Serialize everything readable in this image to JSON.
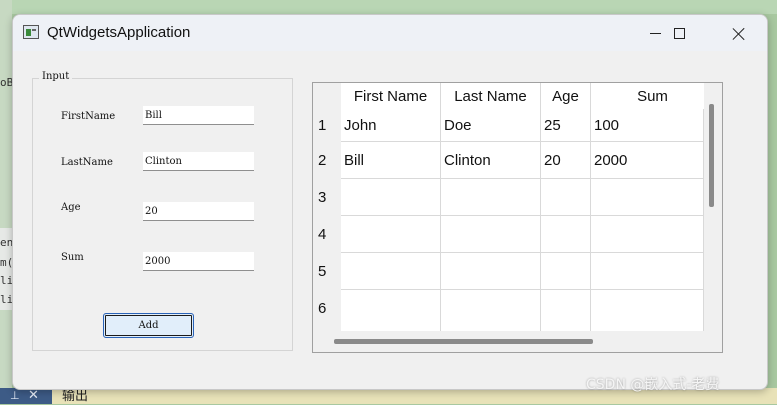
{
  "background": {
    "fragments": [
      "oB",
      "en",
      "m(",
      "li",
      "li"
    ],
    "bottom_panel_label": "输出"
  },
  "window": {
    "title": "QtWidgetsApplication",
    "controls": {
      "minimize": "minimize-icon",
      "maximize": "maximize-icon",
      "close": "close-icon"
    }
  },
  "input_group": {
    "title": "Input",
    "fields": [
      {
        "label": "FirstName",
        "value": "Bill"
      },
      {
        "label": "LastName",
        "value": "Clinton"
      },
      {
        "label": "Age",
        "value": "20"
      },
      {
        "label": "Sum",
        "value": "2000"
      }
    ],
    "add_label": "Add"
  },
  "table": {
    "headers": [
      "First Name",
      "Last Name",
      "Age",
      "Sum"
    ],
    "row_numbers": [
      "1",
      "2",
      "3",
      "4",
      "5",
      "6"
    ],
    "rows": [
      [
        "John",
        "Doe",
        "25",
        "100"
      ],
      [
        "Bill",
        "Clinton",
        "20",
        "2000"
      ],
      [
        "",
        "",
        "",
        ""
      ],
      [
        "",
        "",
        "",
        ""
      ],
      [
        "",
        "",
        "",
        ""
      ],
      [
        "",
        "",
        "",
        ""
      ]
    ]
  },
  "watermark": "CSDN @嵌入式-老费",
  "colors": {
    "accent": "#2a63b8",
    "button_bg": "#e1eefa",
    "window_bg": "#f0f0f0"
  }
}
